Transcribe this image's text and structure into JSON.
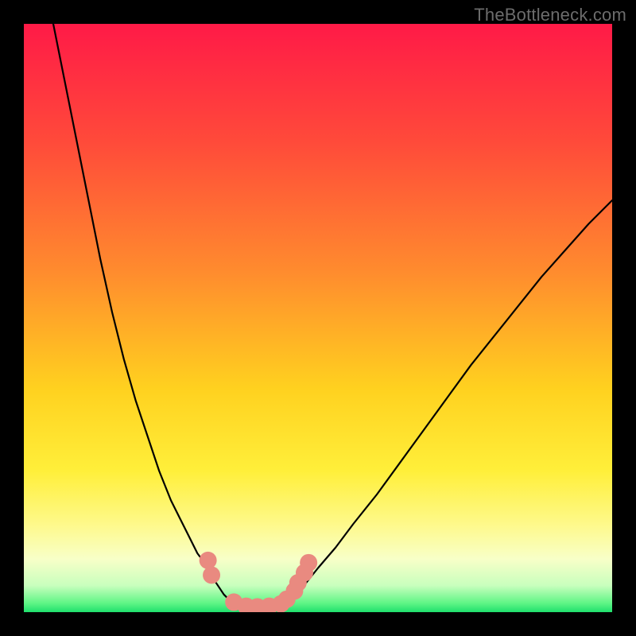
{
  "watermark": "TheBottleneck.com",
  "chart_data": {
    "type": "line",
    "title": "",
    "xlabel": "",
    "ylabel": "",
    "xlim": [
      0,
      100
    ],
    "ylim": [
      0,
      100
    ],
    "grid": false,
    "legend": false,
    "background_gradient_stops": [
      {
        "offset": 0,
        "color": "#ff1a47"
      },
      {
        "offset": 0.2,
        "color": "#ff4a3a"
      },
      {
        "offset": 0.42,
        "color": "#ff8b2e"
      },
      {
        "offset": 0.62,
        "color": "#ffd11f"
      },
      {
        "offset": 0.76,
        "color": "#ffef3a"
      },
      {
        "offset": 0.85,
        "color": "#fef98a"
      },
      {
        "offset": 0.91,
        "color": "#f8ffc8"
      },
      {
        "offset": 0.955,
        "color": "#c8ffbd"
      },
      {
        "offset": 0.985,
        "color": "#5ef585"
      },
      {
        "offset": 1.0,
        "color": "#1fe06d"
      }
    ],
    "series": [
      {
        "name": "left-curve",
        "x": [
          5,
          7,
          9,
          11,
          13,
          15,
          17,
          19,
          21,
          23,
          25,
          26.5,
          28,
          29.5,
          31,
          32,
          33,
          34,
          35,
          36
        ],
        "y": [
          100,
          90,
          80,
          70,
          60,
          51,
          43,
          36,
          30,
          24,
          19,
          16,
          13,
          10,
          8,
          6,
          4.5,
          3,
          2,
          1.3
        ],
        "color": "#000000",
        "line_width": 2.2
      },
      {
        "name": "valley-floor",
        "x": [
          36,
          37,
          38,
          39,
          40,
          41,
          42,
          43,
          44
        ],
        "y": [
          1.3,
          0.9,
          0.8,
          0.8,
          0.8,
          0.9,
          1.0,
          1.1,
          1.3
        ],
        "color": "#000000",
        "line_width": 2.2
      },
      {
        "name": "right-curve",
        "x": [
          44,
          46,
          48,
          50,
          53,
          56,
          60,
          64,
          68,
          72,
          76,
          80,
          84,
          88,
          92,
          96,
          100
        ],
        "y": [
          1.3,
          3,
          5,
          7.5,
          11,
          15,
          20,
          25.5,
          31,
          36.5,
          42,
          47,
          52,
          57,
          61.5,
          66,
          70
        ],
        "color": "#000000",
        "line_width": 2.2
      }
    ],
    "markers": {
      "name": "salmon-dots",
      "color": "#e98a80",
      "radius_px": 11,
      "points": [
        {
          "x": 31.3,
          "y": 8.8
        },
        {
          "x": 31.9,
          "y": 6.3
        },
        {
          "x": 35.7,
          "y": 1.7
        },
        {
          "x": 37.8,
          "y": 1.0
        },
        {
          "x": 39.7,
          "y": 0.9
        },
        {
          "x": 41.7,
          "y": 1.0
        },
        {
          "x": 43.7,
          "y": 1.4
        },
        {
          "x": 44.7,
          "y": 2.2
        },
        {
          "x": 46.0,
          "y": 3.6
        },
        {
          "x": 46.6,
          "y": 5.0
        },
        {
          "x": 47.7,
          "y": 6.7
        },
        {
          "x": 48.4,
          "y": 8.4
        }
      ]
    }
  }
}
